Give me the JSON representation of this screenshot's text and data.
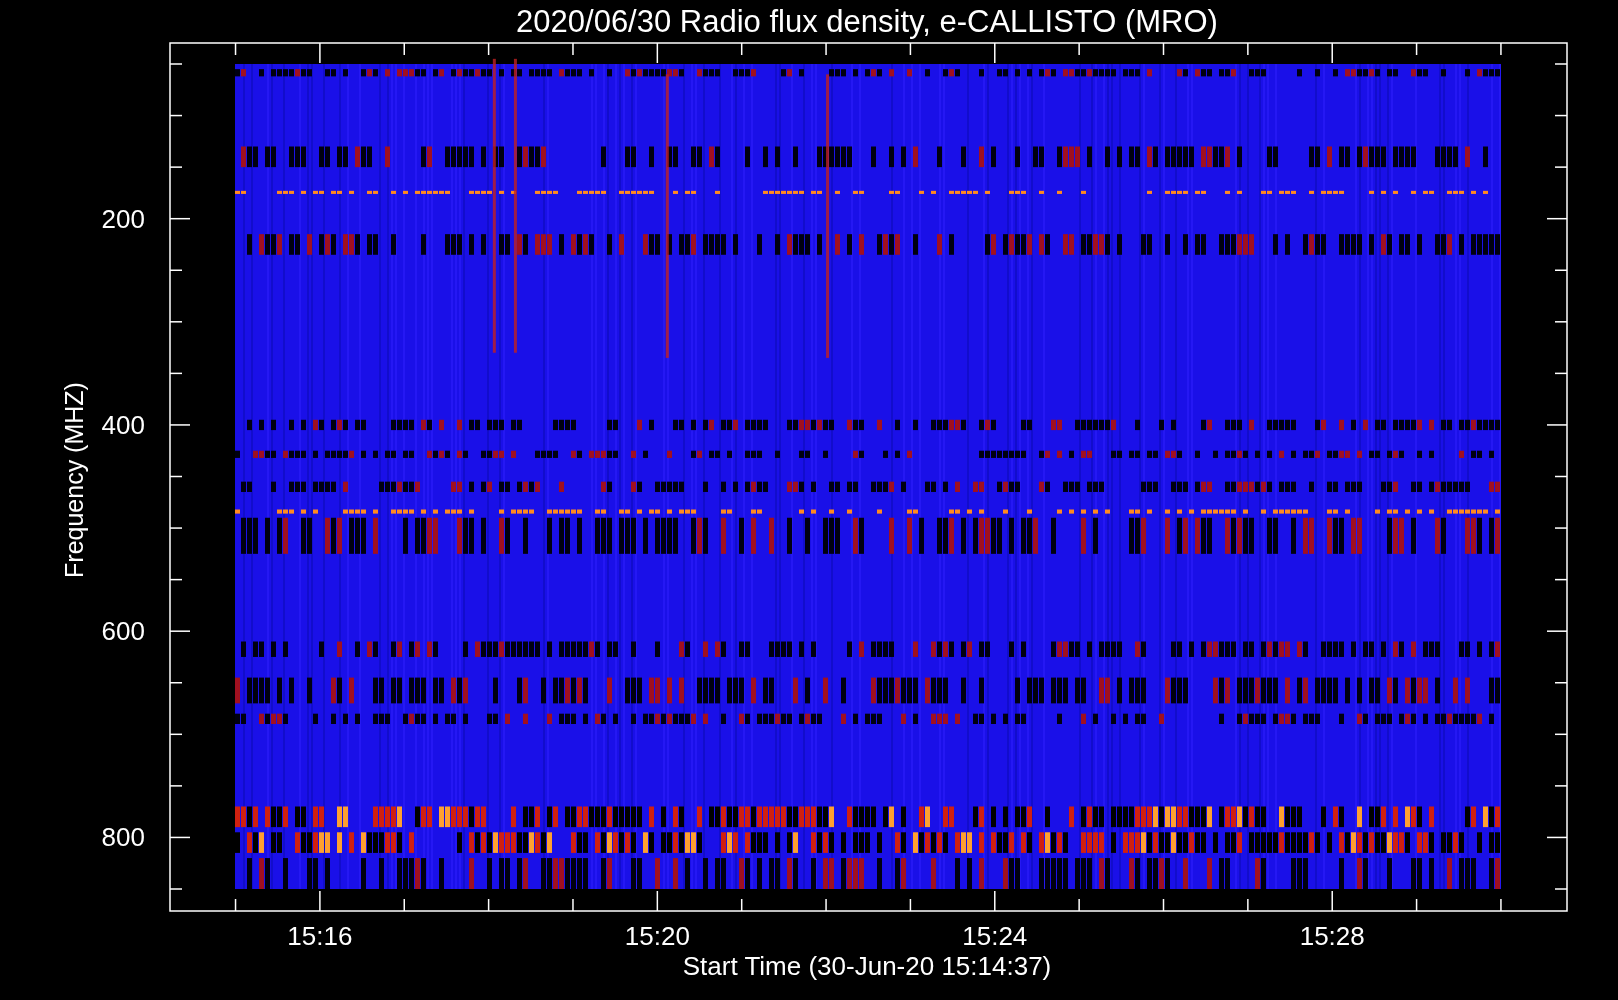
{
  "title": "2020/06/30  Radio flux density, e-CALLISTO (MRO)",
  "y_axis": {
    "label": "Frequency (MHZ)",
    "ticks": [
      "200",
      "400",
      "600",
      "800"
    ]
  },
  "x_axis": {
    "label": "Start Time (30-Jun-20 15:14:37)",
    "ticks": [
      "15:16",
      "15:20",
      "15:24",
      "15:28"
    ]
  }
}
